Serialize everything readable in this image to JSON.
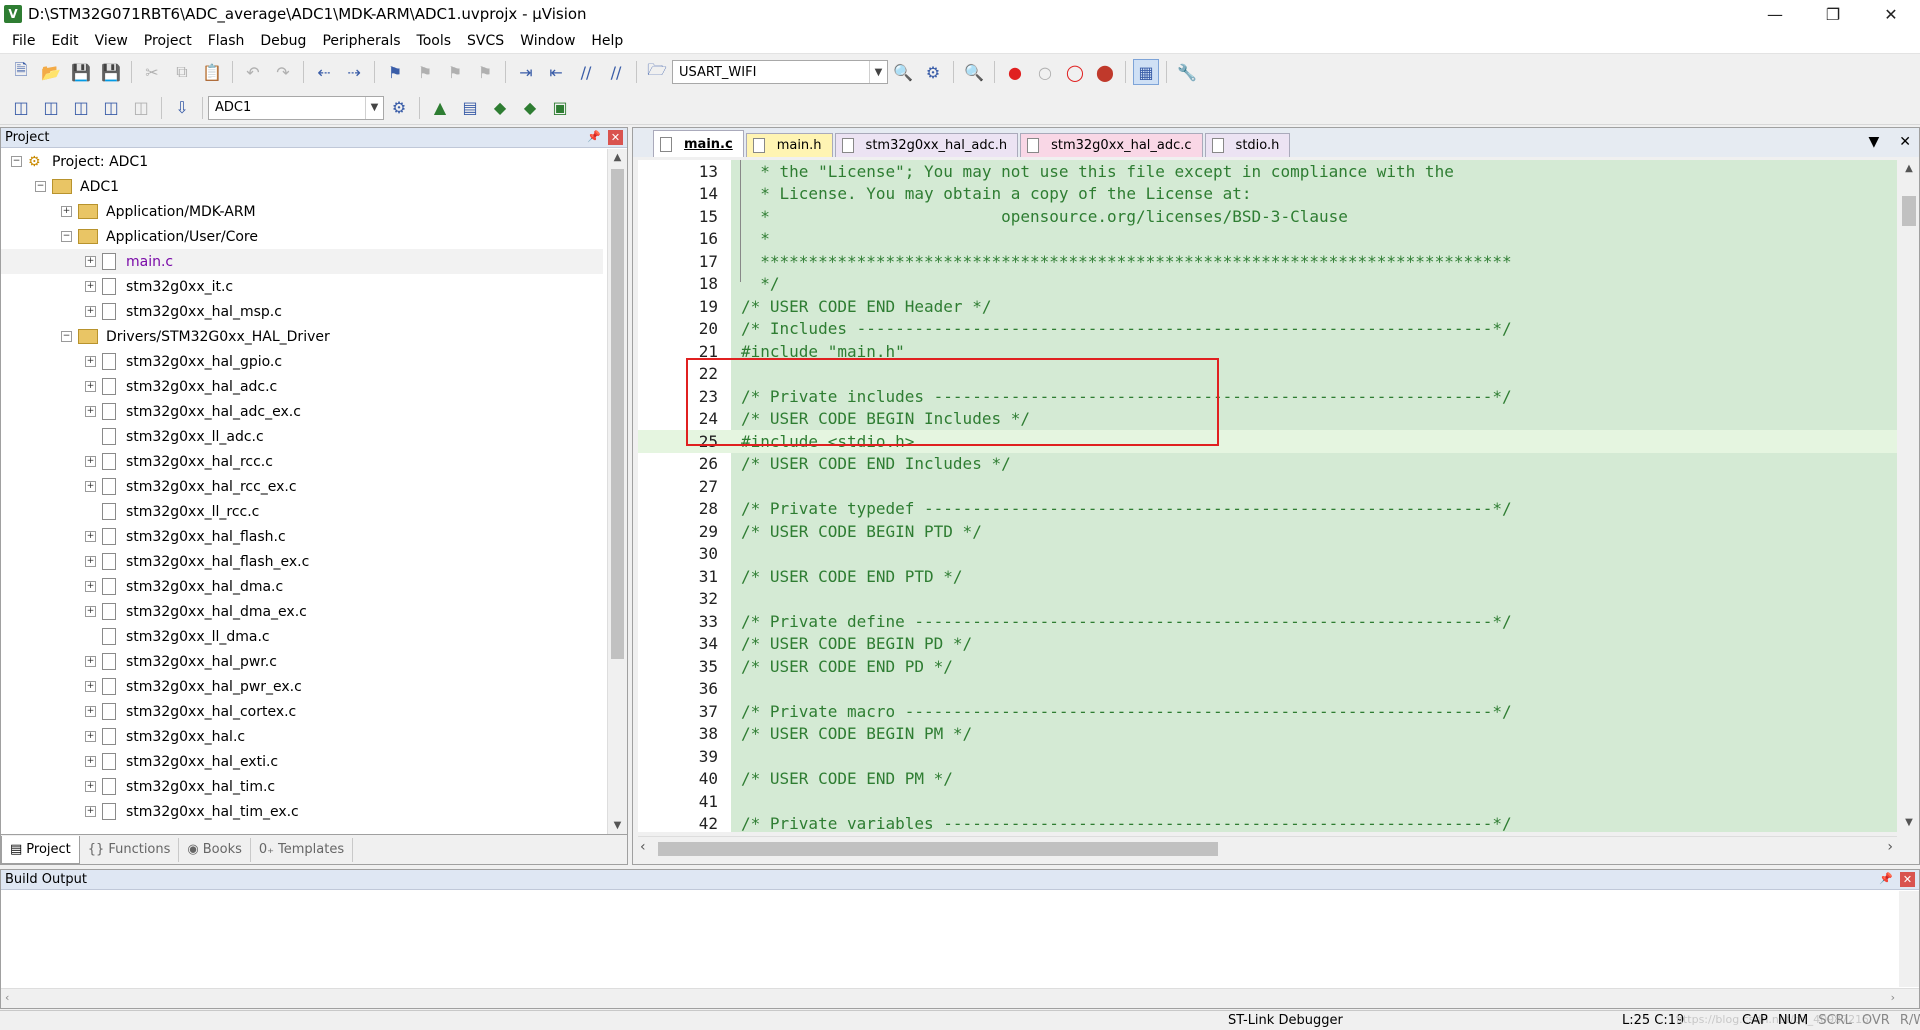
{
  "window": {
    "title": "D:\\STM32G071RBT6\\ADC_average\\ADC1\\MDK-ARM\\ADC1.uvprojx - µVision",
    "app_icon": "V"
  },
  "menu": [
    "File",
    "Edit",
    "View",
    "Project",
    "Flash",
    "Debug",
    "Peripherals",
    "Tools",
    "SVCS",
    "Window",
    "Help"
  ],
  "toolbar": {
    "find_combo": "USART_WIFI",
    "target_combo": "ADC1"
  },
  "project_panel": {
    "title": "Project",
    "root": "Project: ADC1",
    "target": "ADC1",
    "groups": [
      {
        "name": "Application/MDK-ARM",
        "expanded": false,
        "files": []
      },
      {
        "name": "Application/User/Core",
        "expanded": true,
        "files": [
          "main.c",
          "stm32g0xx_it.c",
          "stm32g0xx_hal_msp.c"
        ]
      },
      {
        "name": "Drivers/STM32G0xx_HAL_Driver",
        "expanded": true,
        "files": [
          "stm32g0xx_hal_gpio.c",
          "stm32g0xx_hal_adc.c",
          "stm32g0xx_hal_adc_ex.c",
          "stm32g0xx_ll_adc.c",
          "stm32g0xx_hal_rcc.c",
          "stm32g0xx_hal_rcc_ex.c",
          "stm32g0xx_ll_rcc.c",
          "stm32g0xx_hal_flash.c",
          "stm32g0xx_hal_flash_ex.c",
          "stm32g0xx_hal_dma.c",
          "stm32g0xx_hal_dma_ex.c",
          "stm32g0xx_ll_dma.c",
          "stm32g0xx_hal_pwr.c",
          "stm32g0xx_hal_pwr_ex.c",
          "stm32g0xx_hal_cortex.c",
          "stm32g0xx_hal.c",
          "stm32g0xx_hal_exti.c",
          "stm32g0xx_hal_tim.c",
          "stm32g0xx_hal_tim_ex.c"
        ]
      }
    ],
    "tabs": [
      "Project",
      "Functions",
      "Books",
      "Templates"
    ]
  },
  "editor": {
    "tabs": [
      "main.c",
      "main.h",
      "stm32g0xx_hal_adc.h",
      "stm32g0xx_hal_adc.c",
      "stdio.h"
    ],
    "lines": [
      {
        "n": "13",
        "t": "  * the \"License\"; You may not use this file except in compliance with the"
      },
      {
        "n": "14",
        "t": "  * License. You may obtain a copy of the License at:"
      },
      {
        "n": "15",
        "t": "  *                        opensource.org/licenses/BSD-3-Clause"
      },
      {
        "n": "16",
        "t": "  *"
      },
      {
        "n": "17",
        "t": "  ******************************************************************************"
      },
      {
        "n": "18",
        "t": "  */"
      },
      {
        "n": "19",
        "t": "/* USER CODE END Header */"
      },
      {
        "n": "20",
        "t": "/* Includes ------------------------------------------------------------------*/"
      },
      {
        "n": "21",
        "t": "#include \"main.h\""
      },
      {
        "n": "22",
        "t": ""
      },
      {
        "n": "23",
        "t": "/* Private includes ----------------------------------------------------------*/"
      },
      {
        "n": "24",
        "t": "/* USER CODE BEGIN Includes */"
      },
      {
        "n": "25",
        "t": "#include <stdio.h>"
      },
      {
        "n": "26",
        "t": "/* USER CODE END Includes */"
      },
      {
        "n": "27",
        "t": ""
      },
      {
        "n": "28",
        "t": "/* Private typedef -----------------------------------------------------------*/"
      },
      {
        "n": "29",
        "t": "/* USER CODE BEGIN PTD */"
      },
      {
        "n": "30",
        "t": ""
      },
      {
        "n": "31",
        "t": "/* USER CODE END PTD */"
      },
      {
        "n": "32",
        "t": ""
      },
      {
        "n": "33",
        "t": "/* Private define ------------------------------------------------------------*/"
      },
      {
        "n": "34",
        "t": "/* USER CODE BEGIN PD */"
      },
      {
        "n": "35",
        "t": "/* USER CODE END PD */"
      },
      {
        "n": "36",
        "t": ""
      },
      {
        "n": "37",
        "t": "/* Private macro -------------------------------------------------------------*/"
      },
      {
        "n": "38",
        "t": "/* USER CODE BEGIN PM */"
      },
      {
        "n": "39",
        "t": ""
      },
      {
        "n": "40",
        "t": "/* USER CODE END PM */"
      },
      {
        "n": "41",
        "t": ""
      },
      {
        "n": "42",
        "t": "/* Private variables ---------------------------------------------------------*/"
      }
    ]
  },
  "build_output": {
    "title": "Build Output"
  },
  "status": {
    "debugger": "ST-Link Debugger",
    "position": "L:25 C:19",
    "watermark": "https://blog.csdn.net/qq_40987215",
    "indicators": [
      "CAP",
      "NUM",
      "SCRL",
      "OVR",
      "R/W"
    ]
  }
}
